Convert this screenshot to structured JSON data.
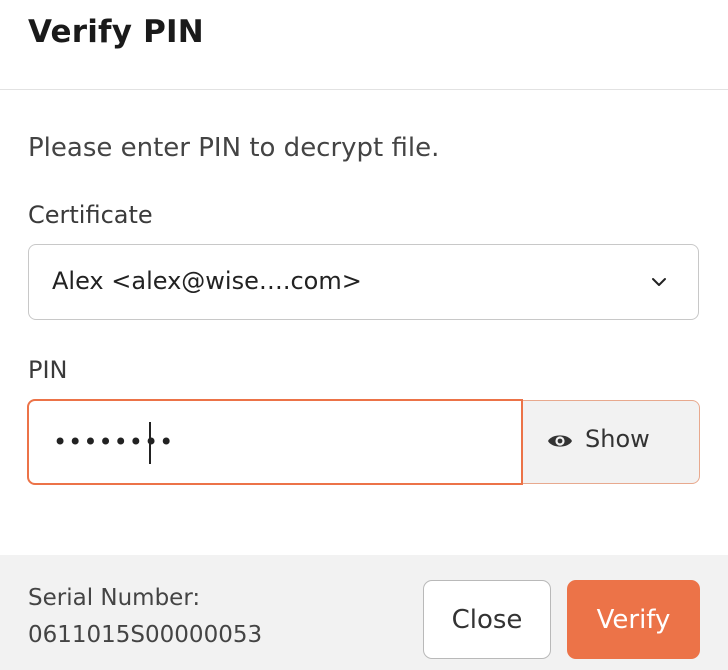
{
  "dialog": {
    "title": "Verify PIN",
    "message": "Please enter PIN to decrypt file."
  },
  "certificate": {
    "label": "Certificate",
    "selected": "Alex <alex@wise….com>",
    "chevron_icon": "chevron-down-icon"
  },
  "pin": {
    "label": "PIN",
    "value": "••••••••",
    "show_label": "Show",
    "show_icon": "eye-icon"
  },
  "footer": {
    "serial_label": "Serial Number:",
    "serial_value": "0611015S00000053",
    "close_label": "Close",
    "verify_label": "Verify"
  },
  "colors": {
    "accent": "#ec7348",
    "footer_bg": "#f2f2f2",
    "border": "#c8c8c8"
  }
}
